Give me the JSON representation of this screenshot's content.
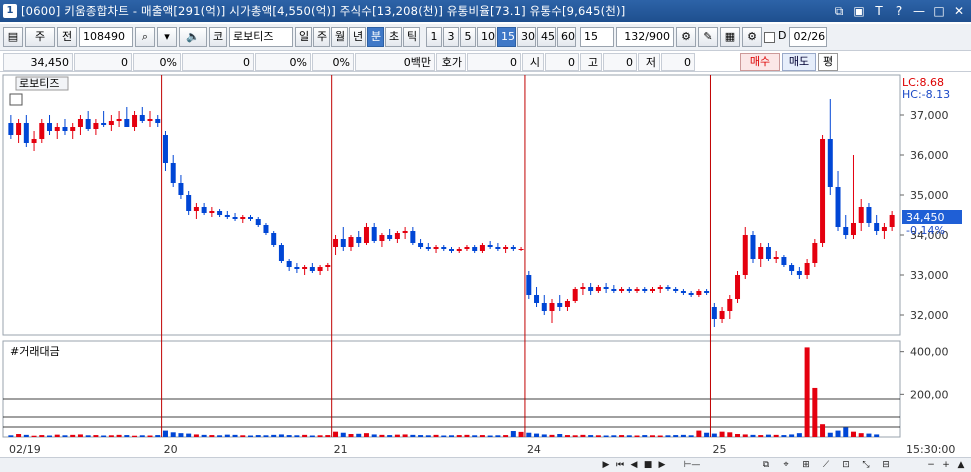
{
  "window": {
    "number": "1",
    "title": "[0600] 키움종합차트 - 매출액[291(억)] 시가총액[4,550(억)] 주식수[13,208(천)] 유통비율[73.1] 유통수[9,645(천)]"
  },
  "toolbar": {
    "period": "주",
    "prev_btn": "전",
    "code": "108490",
    "market": "코",
    "stock_name": "로보티즈",
    "tf_tabs": [
      "일",
      "주",
      "월",
      "년",
      "분",
      "초",
      "틱"
    ],
    "tf_active": "분",
    "minute_values": [
      "1",
      "3",
      "5",
      "10",
      "15",
      "30",
      "45",
      "60"
    ],
    "minute_active": "15",
    "interval_select": "15",
    "bar_count": "132",
    "bar_total": "/900",
    "date_label": "D",
    "date_value": "02/26"
  },
  "quote": {
    "price": "34,450",
    "change": "0",
    "change_pct": "0%",
    "vol": "0",
    "vol_pct": "0%",
    "amt_pct": "0%",
    "amount": "0백만",
    "hoga_label": "호가",
    "hoga": "0",
    "si_label": "시",
    "si": "0",
    "go_label": "고",
    "go": "0",
    "jeo_label": "저",
    "jeo": "0",
    "buy_btn": "매수",
    "sell_btn": "매도",
    "avg_btn": "평"
  },
  "chart_labels": {
    "price_title": "로보티즈",
    "lc": "LC:8.68",
    "hc": "HC:-8.13",
    "current_price": "34,450",
    "current_change": "-0.14%",
    "volume_title": "#거래대금",
    "time_label": "15:30:00"
  },
  "colors": {
    "up": "#e4000f",
    "down": "#0046d5",
    "day_separator": "#c00000",
    "price_tag_bg": "#1f5fd6"
  },
  "chart_data": {
    "type": "candlestick",
    "price_axis": {
      "ticks": [
        "37,000",
        "36,000",
        "35,000",
        "34,000",
        "33,000",
        "32,000"
      ],
      "ylim": [
        31500,
        38000
      ]
    },
    "volume_axis": {
      "ticks": [
        "400,00",
        "200,00"
      ],
      "ylim": [
        0,
        450
      ]
    },
    "date_labels": [
      "02/19",
      "20",
      "21",
      "24",
      "25"
    ],
    "candles": [
      [
        36800,
        37000,
        36400,
        36500
      ],
      [
        36500,
        36900,
        36300,
        36800
      ],
      [
        36800,
        37000,
        36200,
        36300
      ],
      [
        36300,
        36600,
        36100,
        36400
      ],
      [
        36400,
        36900,
        36300,
        36800
      ],
      [
        36800,
        37000,
        36500,
        36600
      ],
      [
        36600,
        36800,
        36400,
        36700
      ],
      [
        36700,
        36900,
        36500,
        36600
      ],
      [
        36600,
        36800,
        36400,
        36700
      ],
      [
        36700,
        37000,
        36500,
        36900
      ],
      [
        36900,
        37100,
        36600,
        36650
      ],
      [
        36650,
        36900,
        36500,
        36800
      ],
      [
        36800,
        37100,
        36700,
        36750
      ],
      [
        36750,
        37000,
        36600,
        36850
      ],
      [
        36850,
        37100,
        36700,
        36900
      ],
      [
        36900,
        37200,
        36800,
        36700
      ],
      [
        36700,
        37100,
        36600,
        37000
      ],
      [
        37000,
        37200,
        36800,
        36850
      ],
      [
        36850,
        37100,
        36700,
        36900
      ],
      [
        36900,
        37000,
        36700,
        36800
      ],
      [
        36500,
        36600,
        35600,
        35800
      ],
      [
        35800,
        36000,
        35200,
        35300
      ],
      [
        35300,
        35500,
        34900,
        35000
      ],
      [
        35000,
        35100,
        34500,
        34600
      ],
      [
        34600,
        34800,
        34400,
        34700
      ],
      [
        34700,
        34800,
        34500,
        34550
      ],
      [
        34550,
        34700,
        34450,
        34600
      ],
      [
        34600,
        34650,
        34450,
        34500
      ],
      [
        34500,
        34600,
        34400,
        34450
      ],
      [
        34450,
        34550,
        34350,
        34400
      ],
      [
        34400,
        34500,
        34300,
        34450
      ],
      [
        34450,
        34500,
        34350,
        34400
      ],
      [
        34400,
        34450,
        34200,
        34250
      ],
      [
        34250,
        34300,
        34000,
        34050
      ],
      [
        34050,
        34100,
        33700,
        33750
      ],
      [
        33750,
        33800,
        33300,
        33350
      ],
      [
        33350,
        33400,
        33100,
        33200
      ],
      [
        33200,
        33300,
        33050,
        33150
      ],
      [
        33150,
        33250,
        33000,
        33200
      ],
      [
        33200,
        33300,
        33050,
        33100
      ],
      [
        33100,
        33250,
        33000,
        33200
      ],
      [
        33200,
        33300,
        33100,
        33250
      ],
      [
        33700,
        34000,
        33500,
        33900
      ],
      [
        33900,
        34200,
        33600,
        33700
      ],
      [
        33700,
        34000,
        33600,
        33950
      ],
      [
        33950,
        34100,
        33700,
        33800
      ],
      [
        33800,
        34300,
        33750,
        34200
      ],
      [
        34200,
        34300,
        33800,
        33850
      ],
      [
        33850,
        34050,
        33700,
        34000
      ],
      [
        34000,
        34150,
        33850,
        33900
      ],
      [
        33900,
        34100,
        33800,
        34050
      ],
      [
        34050,
        34200,
        33900,
        34100
      ],
      [
        34100,
        34200,
        33750,
        33800
      ],
      [
        33800,
        33900,
        33650,
        33700
      ],
      [
        33700,
        33800,
        33600,
        33650
      ],
      [
        33650,
        33750,
        33550,
        33700
      ],
      [
        33700,
        33750,
        33600,
        33650
      ],
      [
        33650,
        33700,
        33550,
        33600
      ],
      [
        33600,
        33700,
        33550,
        33650
      ],
      [
        33650,
        33750,
        33600,
        33700
      ],
      [
        33700,
        33750,
        33550,
        33600
      ],
      [
        33600,
        33800,
        33550,
        33750
      ],
      [
        33750,
        33850,
        33650,
        33700
      ],
      [
        33700,
        33800,
        33600,
        33650
      ],
      [
        33650,
        33750,
        33550,
        33700
      ],
      [
        33700,
        33750,
        33600,
        33650
      ],
      [
        33650,
        33700,
        33600,
        33650
      ],
      [
        33000,
        33100,
        32400,
        32500
      ],
      [
        32500,
        32700,
        32200,
        32300
      ],
      [
        32300,
        32500,
        32000,
        32100
      ],
      [
        32100,
        32400,
        31800,
        32300
      ],
      [
        32300,
        32500,
        32100,
        32200
      ],
      [
        32200,
        32400,
        32100,
        32350
      ],
      [
        32350,
        32700,
        32300,
        32650
      ],
      [
        32650,
        32800,
        32500,
        32700
      ],
      [
        32700,
        32800,
        32500,
        32600
      ],
      [
        32600,
        32750,
        32550,
        32700
      ],
      [
        32700,
        32800,
        32550,
        32650
      ],
      [
        32650,
        32750,
        32550,
        32600
      ],
      [
        32600,
        32700,
        32550,
        32650
      ],
      [
        32650,
        32700,
        32550,
        32600
      ],
      [
        32600,
        32700,
        32550,
        32650
      ],
      [
        32650,
        32700,
        32550,
        32600
      ],
      [
        32600,
        32700,
        32550,
        32650
      ],
      [
        32650,
        32750,
        32550,
        32700
      ],
      [
        32700,
        32750,
        32600,
        32650
      ],
      [
        32650,
        32700,
        32550,
        32600
      ],
      [
        32600,
        32650,
        32500,
        32550
      ],
      [
        32550,
        32600,
        32450,
        32500
      ],
      [
        32500,
        32650,
        32450,
        32600
      ],
      [
        32600,
        32650,
        32500,
        32550
      ],
      [
        32200,
        32300,
        31700,
        31900
      ],
      [
        31900,
        32200,
        31800,
        32100
      ],
      [
        32100,
        32500,
        31900,
        32400
      ],
      [
        32400,
        33100,
        32300,
        33000
      ],
      [
        33000,
        34200,
        32900,
        34000
      ],
      [
        34000,
        34100,
        33300,
        33400
      ],
      [
        33400,
        33800,
        33200,
        33700
      ],
      [
        33700,
        33800,
        33350,
        33400
      ],
      [
        33400,
        33600,
        33300,
        33450
      ],
      [
        33450,
        33500,
        33200,
        33250
      ],
      [
        33250,
        33300,
        33000,
        33100
      ],
      [
        33100,
        33200,
        32900,
        33000
      ],
      [
        33000,
        33400,
        32900,
        33300
      ],
      [
        33300,
        33900,
        33200,
        33800
      ],
      [
        33800,
        36500,
        33700,
        36400
      ],
      [
        36400,
        37400,
        35000,
        35200
      ],
      [
        35200,
        35600,
        34100,
        34200
      ],
      [
        34200,
        34500,
        33900,
        34000
      ],
      [
        34000,
        36000,
        33900,
        34300
      ],
      [
        34300,
        34900,
        34100,
        34700
      ],
      [
        34700,
        34800,
        34200,
        34300
      ],
      [
        34300,
        34500,
        34000,
        34100
      ],
      [
        34100,
        34300,
        33900,
        34200
      ],
      [
        34200,
        34600,
        34100,
        34500
      ]
    ],
    "volume": [
      8,
      14,
      10,
      6,
      9,
      7,
      11,
      8,
      10,
      12,
      8,
      9,
      7,
      8,
      10,
      9,
      6,
      8,
      7,
      9,
      30,
      22,
      18,
      16,
      12,
      10,
      9,
      8,
      11,
      10,
      8,
      7,
      9,
      8,
      10,
      12,
      9,
      8,
      10,
      7,
      8,
      9,
      25,
      20,
      14,
      15,
      18,
      12,
      10,
      9,
      11,
      12,
      10,
      9,
      8,
      10,
      7,
      8,
      9,
      10,
      8,
      9,
      7,
      8,
      9,
      28,
      24,
      20,
      16,
      12,
      10,
      14,
      9,
      8,
      10,
      9,
      8,
      7,
      8,
      9,
      8,
      7,
      9,
      8,
      7,
      8,
      9,
      10,
      8,
      30,
      20,
      16,
      25,
      22,
      14,
      12,
      10,
      9,
      11,
      10,
      9,
      12,
      18,
      420,
      230,
      60,
      20,
      30,
      45,
      25,
      18,
      16,
      12
    ]
  }
}
